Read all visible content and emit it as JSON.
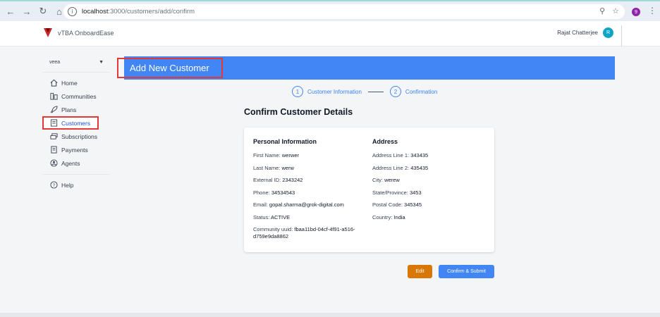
{
  "browser": {
    "url_host": "localhost",
    "url_path": ":3000/customers/add/confirm"
  },
  "header": {
    "app_name": "vTBA OnboardEase",
    "user_name": "Rajat Chatterjee",
    "user_initial": "R",
    "profile_initial": "9"
  },
  "sidebar": {
    "org": "veea",
    "items": [
      {
        "label": "Home",
        "icon": "home-icon"
      },
      {
        "label": "Communities",
        "icon": "buildings-icon"
      },
      {
        "label": "Plans",
        "icon": "rocket-icon"
      },
      {
        "label": "Customers",
        "icon": "id-card-icon",
        "active": true
      },
      {
        "label": "Subscriptions",
        "icon": "layers-icon"
      },
      {
        "label": "Payments",
        "icon": "receipt-icon"
      },
      {
        "label": "Agents",
        "icon": "agent-icon"
      }
    ],
    "help": "Help"
  },
  "main": {
    "title": "Add New Customer",
    "steps": [
      {
        "num": "1",
        "label": "Customer Information"
      },
      {
        "num": "2",
        "label": "Confirmation"
      }
    ],
    "confirm_title": "Confirm Customer Details",
    "personal": {
      "heading": "Personal Information",
      "first_name_label": "First Name: ",
      "first_name": "werwer",
      "last_name_label": "Last Name: ",
      "last_name": "werw",
      "external_id_label": "External ID: ",
      "external_id": "2343242",
      "phone_label": "Phone: ",
      "phone": "34534543",
      "email_label": "Email: ",
      "email": "gopal.sharma@grok-digital.com",
      "status_label": "Status: ",
      "status": "ACTIVE",
      "community_label": "Community uuid: ",
      "community_uuid": "fbaa11bd-04cf-4f91-a516-d759e9da8862"
    },
    "address": {
      "heading": "Address",
      "line1_label": "Address Line 1: ",
      "line1": "343435",
      "line2_label": "Address Line 2: ",
      "line2": "435435",
      "city_label": "City: ",
      "city": "werew",
      "state_label": "State/Province: ",
      "state": "3453",
      "postal_label": "Postal Code: ",
      "postal": "345345",
      "country_label": "Country: ",
      "country": "India"
    },
    "edit_label": "Edit",
    "confirm_label": "Confirm & Submit"
  },
  "colors": {
    "primary": "#4285f4",
    "edit": "#d97706",
    "highlight": "#e53935"
  }
}
